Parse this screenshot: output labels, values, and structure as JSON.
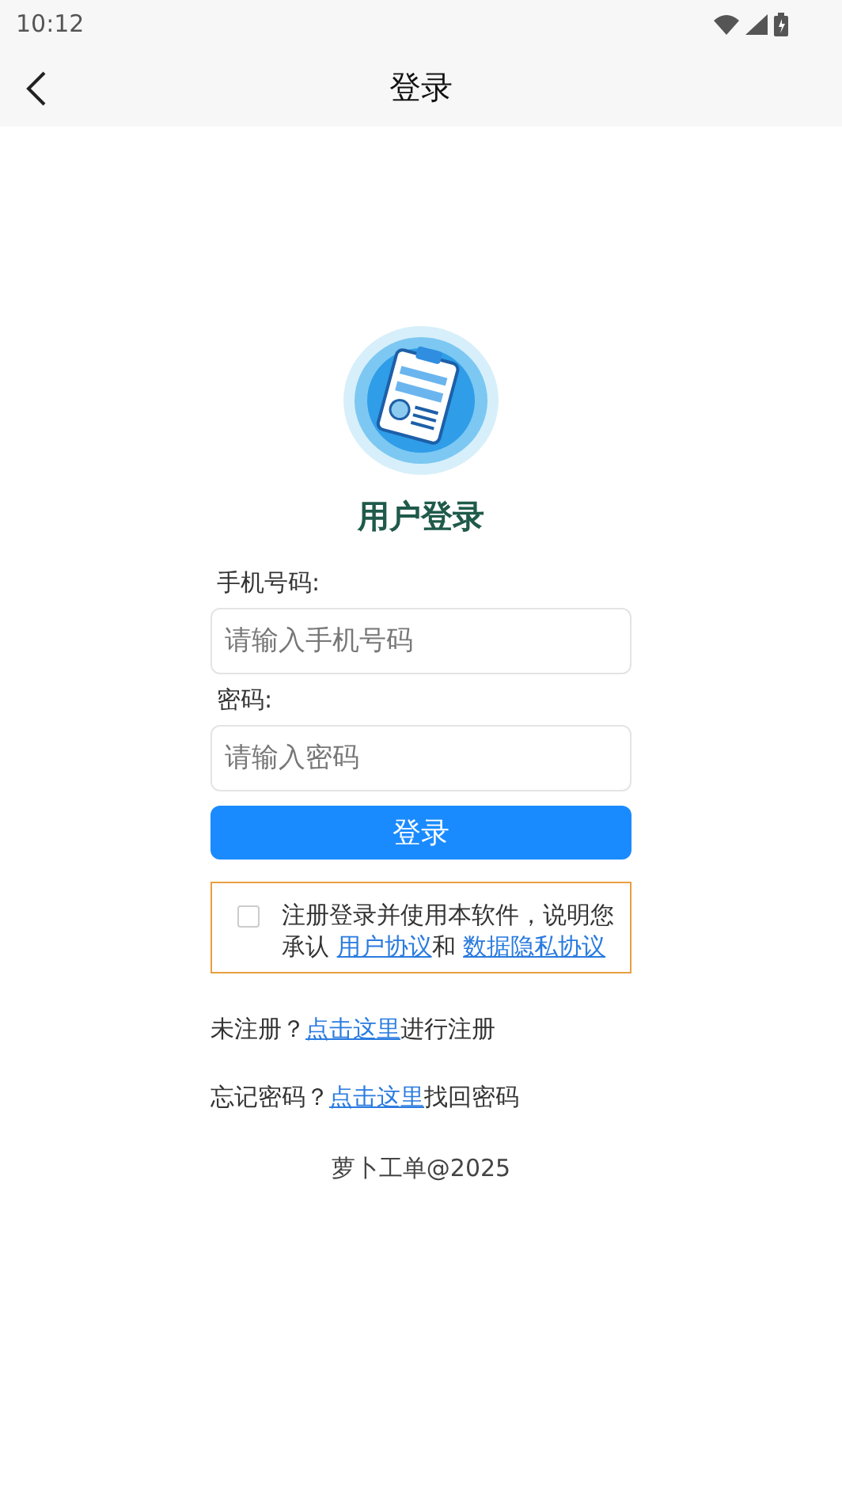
{
  "status_bar": {
    "time": "10:12"
  },
  "header": {
    "title": "登录"
  },
  "login": {
    "title": "用户登录",
    "fields": [
      {
        "label": "手机号码:",
        "placeholder": "请输入手机号码"
      },
      {
        "label": "密码:",
        "placeholder": "请输入密码"
      }
    ],
    "submit": "登录",
    "agreement": {
      "checked": false,
      "text": "注册登录并使用本软件，说明您承认 ",
      "link_1": "用户协议",
      "middle": "和 ",
      "link_2": "数据隐私协议"
    },
    "links": [
      {
        "before": "未注册？",
        "link": "点击这里",
        "after": "进行注册"
      },
      {
        "before": "忘记密码？",
        "link": "点击这里",
        "after": "找回密码"
      }
    ],
    "footer": "萝卜工单@2025"
  }
}
